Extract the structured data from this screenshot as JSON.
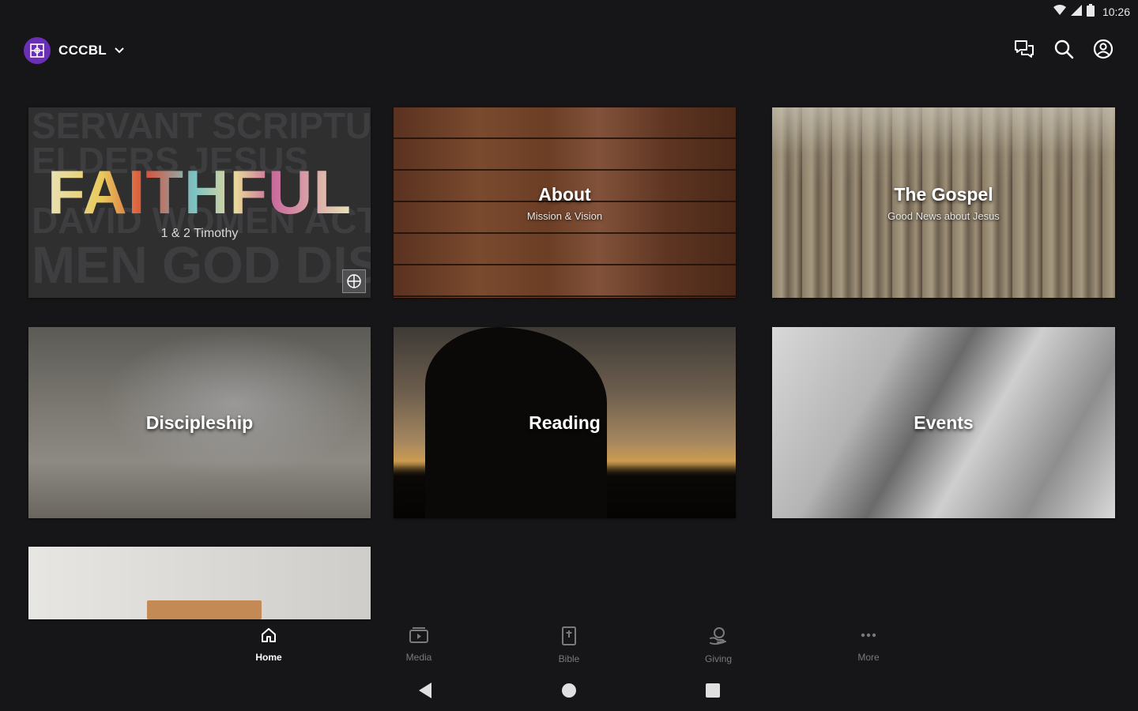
{
  "status_bar": {
    "time": "10:26"
  },
  "header": {
    "org_name": "CCCBL"
  },
  "tiles": {
    "faithful": {
      "title": "FAITHFUL",
      "subtitle": "1 & 2 Timothy",
      "bg_lines": [
        "SERVANT SCRIPTURE",
        "ELDERS JESUS",
        "DAVID WOMEN ACTS",
        "MEN GOD DISCIPLES WOM"
      ]
    },
    "about": {
      "title": "About",
      "subtitle": "Mission & Vision"
    },
    "gospel": {
      "title": "The Gospel",
      "subtitle": "Good News about Jesus"
    },
    "discipleship": {
      "title": "Discipleship"
    },
    "reading": {
      "title": "Reading"
    },
    "events": {
      "title": "Events"
    }
  },
  "bottom_nav": {
    "items": [
      {
        "label": "Home",
        "icon": "home-icon",
        "active": true
      },
      {
        "label": "Media",
        "icon": "media-icon",
        "active": false
      },
      {
        "label": "Bible",
        "icon": "bible-icon",
        "active": false
      },
      {
        "label": "Giving",
        "icon": "giving-icon",
        "active": false
      },
      {
        "label": "More",
        "icon": "more-icon",
        "active": false
      }
    ]
  },
  "colors": {
    "background": "#161618",
    "brand_purple": "#6a2fb5",
    "nav_inactive": "#7a7a7c",
    "nav_active": "#ffffff"
  }
}
